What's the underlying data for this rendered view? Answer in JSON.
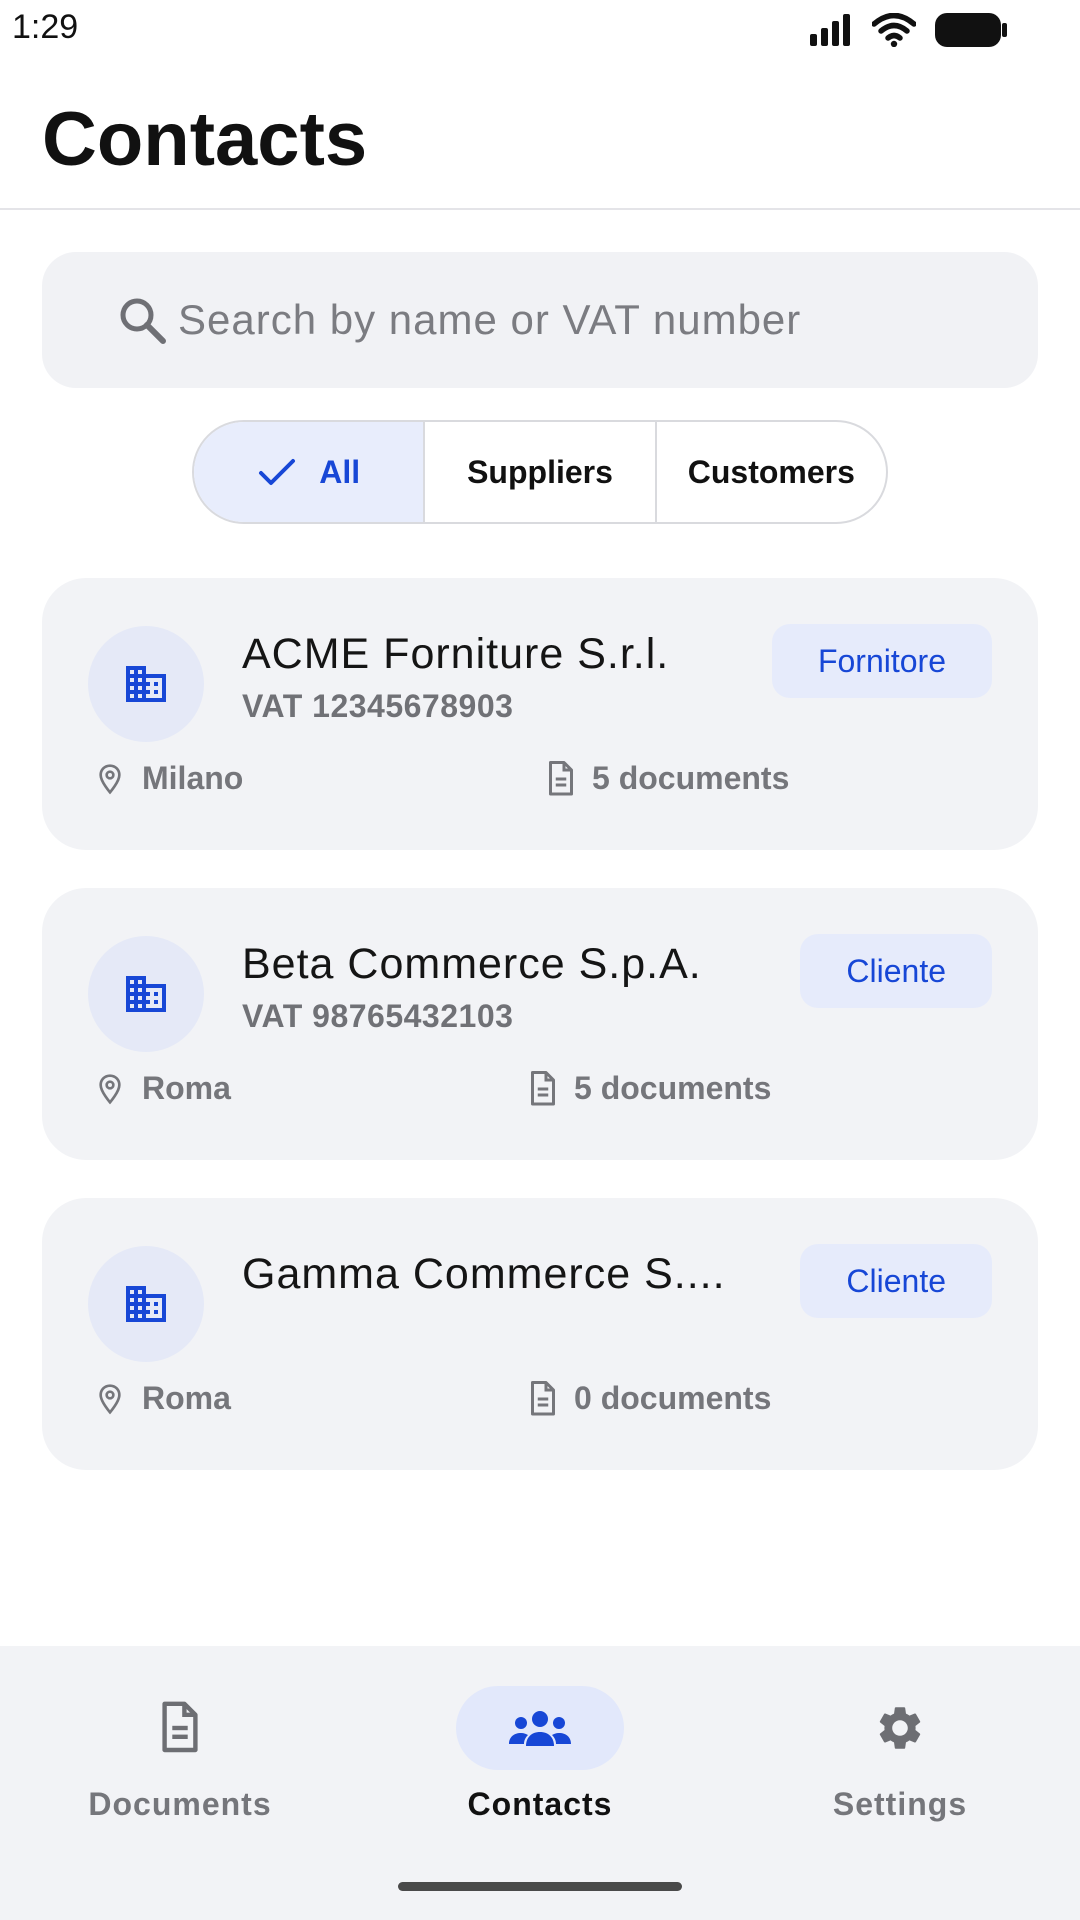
{
  "status_bar": {
    "time": "1:29"
  },
  "header": {
    "title": "Contacts"
  },
  "search": {
    "placeholder": "Search by name or VAT number",
    "value": ""
  },
  "filters": [
    {
      "label": "All",
      "selected": true
    },
    {
      "label": "Suppliers",
      "selected": false
    },
    {
      "label": "Customers",
      "selected": false
    }
  ],
  "contacts": [
    {
      "name": "ACME Forniture S.r.l.",
      "vat": "VAT 12345678903",
      "badge": "Fornitore",
      "city": "Milano",
      "documents": "5 documents",
      "icon": "building-icon"
    },
    {
      "name": "Beta Commerce S.p.A.",
      "vat": "VAT 98765432103",
      "badge": "Cliente",
      "city": "Roma",
      "documents": "5 documents",
      "icon": "building-icon"
    },
    {
      "name": "Gamma Commerce S....",
      "vat": "",
      "badge": "Cliente",
      "city": "Roma",
      "documents": "0 documents",
      "icon": "building-icon"
    }
  ],
  "bottom_nav": [
    {
      "label": "Documents",
      "icon": "document-icon",
      "active": false
    },
    {
      "label": "Contacts",
      "icon": "people-icon",
      "active": true
    },
    {
      "label": "Settings",
      "icon": "gear-icon",
      "active": false
    }
  ],
  "colors": {
    "accent": "#1747d6",
    "accent_bg": "#e6ebfb",
    "card_bg": "#f2f3f6",
    "muted_text": "#75767b"
  }
}
